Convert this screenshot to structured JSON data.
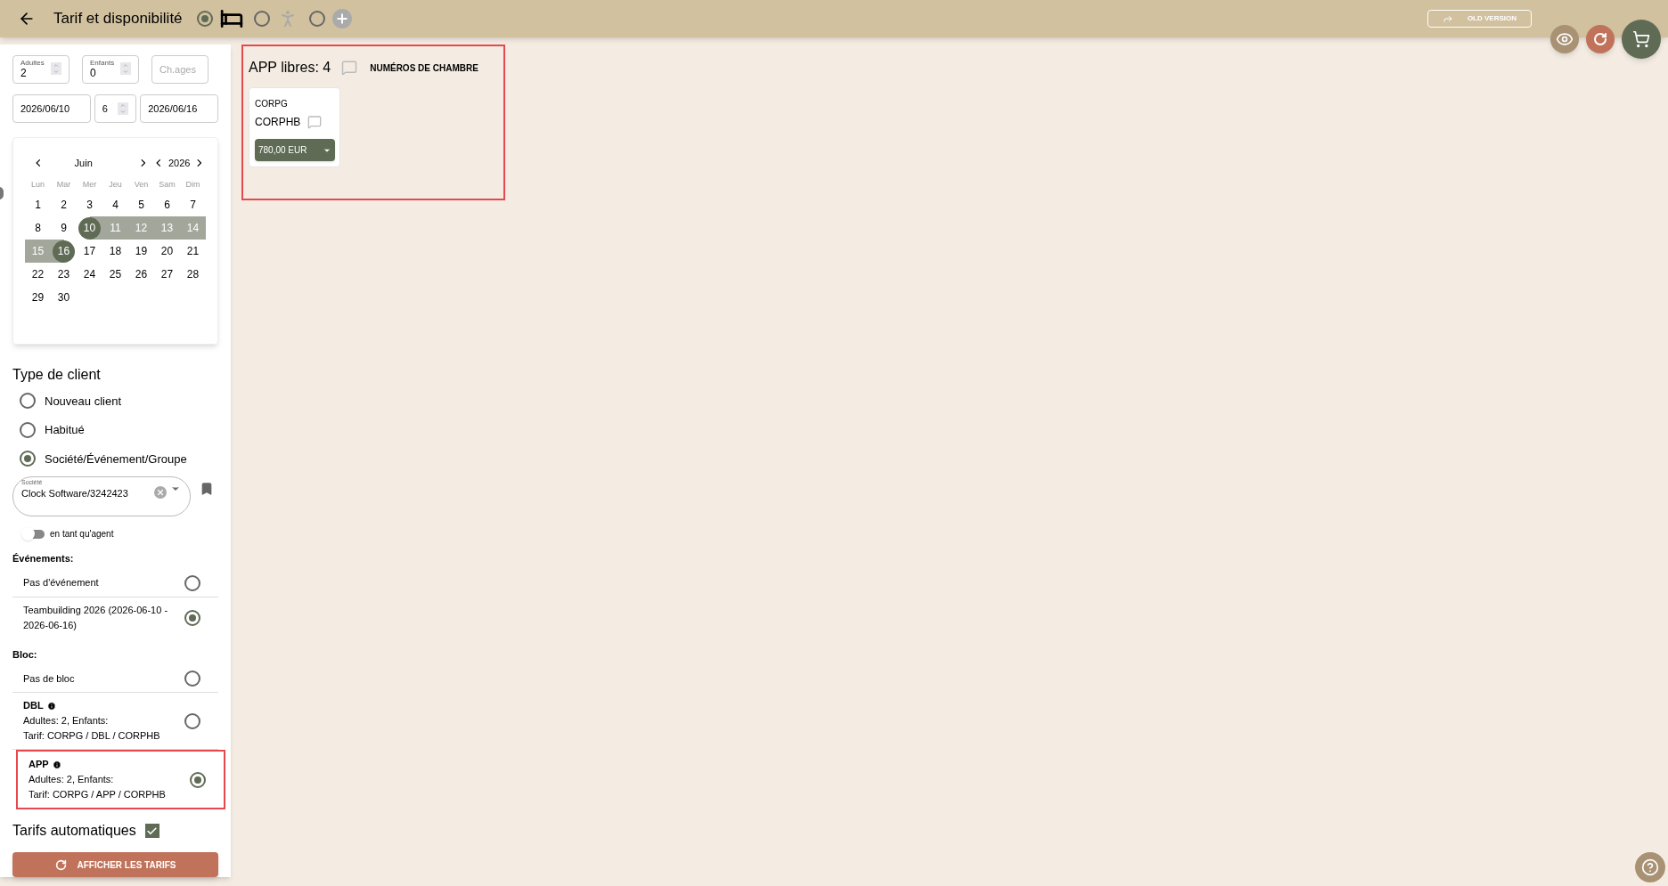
{
  "header": {
    "title": "Tarif et disponibilité",
    "modes": [
      {
        "kind": "bed",
        "selected": true
      },
      {
        "kind": "walk",
        "selected": false
      },
      {
        "kind": "add",
        "selected": false
      }
    ],
    "old_version": "OLD VERSION"
  },
  "search": {
    "adults": {
      "label": "Adultes",
      "value": "2"
    },
    "children": {
      "label": "Enfants",
      "value": "0"
    },
    "ages": {
      "placeholder": "Ch.ages"
    },
    "arrival": "2026/06/10",
    "nights": "6",
    "departure": "2026/06/16"
  },
  "calendar": {
    "month": "Juin",
    "year": "2026",
    "weekdays": [
      "Lun",
      "Mar",
      "Mer",
      "Jeu",
      "Ven",
      "Sam",
      "Dim"
    ],
    "weeks": [
      [
        {
          "day": "1",
          "selected": false,
          "in_range": false
        },
        {
          "day": "2",
          "selected": false,
          "in_range": false
        },
        {
          "day": "3",
          "selected": false,
          "in_range": false
        },
        {
          "day": "4",
          "selected": false,
          "in_range": false
        },
        {
          "day": "5",
          "selected": false,
          "in_range": false
        },
        {
          "day": "6",
          "selected": false,
          "in_range": false
        },
        {
          "day": "7",
          "selected": false,
          "in_range": false
        }
      ],
      [
        {
          "day": "8",
          "selected": false,
          "in_range": false
        },
        {
          "day": "9",
          "selected": false,
          "in_range": false
        },
        {
          "day": "10",
          "selected": true,
          "in_range": false
        },
        {
          "day": "11",
          "selected": false,
          "in_range": true
        },
        {
          "day": "12",
          "selected": false,
          "in_range": true
        },
        {
          "day": "13",
          "selected": false,
          "in_range": true
        },
        {
          "day": "14",
          "selected": false,
          "in_range": true
        }
      ],
      [
        {
          "day": "15",
          "selected": false,
          "in_range": true
        },
        {
          "day": "16",
          "selected": true,
          "in_range": false
        },
        {
          "day": "17",
          "selected": false,
          "in_range": false
        },
        {
          "day": "18",
          "selected": false,
          "in_range": false
        },
        {
          "day": "19",
          "selected": false,
          "in_range": false
        },
        {
          "day": "20",
          "selected": false,
          "in_range": false
        },
        {
          "day": "21",
          "selected": false,
          "in_range": false
        }
      ],
      [
        {
          "day": "22",
          "selected": false,
          "in_range": false
        },
        {
          "day": "23",
          "selected": false,
          "in_range": false
        },
        {
          "day": "24",
          "selected": false,
          "in_range": false
        },
        {
          "day": "25",
          "selected": false,
          "in_range": false
        },
        {
          "day": "26",
          "selected": false,
          "in_range": false
        },
        {
          "day": "27",
          "selected": false,
          "in_range": false
        },
        {
          "day": "28",
          "selected": false,
          "in_range": false
        }
      ],
      [
        {
          "day": "29",
          "selected": false,
          "in_range": false
        },
        {
          "day": "30",
          "selected": false,
          "in_range": false
        }
      ]
    ]
  },
  "client_type": {
    "title": "Type de client",
    "options": [
      {
        "label": "Nouveau client",
        "selected": false
      },
      {
        "label": "Habitué",
        "selected": false
      },
      {
        "label": "Société/Événement/Groupe",
        "selected": true
      }
    ],
    "company": {
      "label": "Société",
      "value": "Clock Software/3242423"
    },
    "agent": {
      "label": "en tant qu'agent",
      "on": false
    }
  },
  "events": {
    "title": "Événements:",
    "items": [
      {
        "label": "Pas d'événement",
        "selected": false
      },
      {
        "label": "Teambuilding 2026 (2026-06-10 - 2026-06-16)",
        "selected": true
      }
    ]
  },
  "blocks": {
    "title": "Bloc:",
    "items": [
      {
        "kind": "none",
        "label": "Pas de bloc",
        "selected": false,
        "highlighted": false
      },
      {
        "kind": "block",
        "name": "DBL",
        "guests": "Adultes: 2, Enfants:",
        "rate": "Tarif: CORPG / DBL / CORPHB",
        "selected": false,
        "highlighted": false
      },
      {
        "kind": "block",
        "name": "APP",
        "guests": "Adultes: 2, Enfants:",
        "rate": "Tarif: CORPG / APP / CORPHB",
        "selected": true,
        "highlighted": true
      }
    ]
  },
  "auto_rates": {
    "label": "Tarifs automatiques",
    "checked": true
  },
  "show_rates_button": "AFFICHER LES TARIFS",
  "availability": {
    "highlighted": true,
    "title": "APP libres: 4",
    "room_numbers": "NUMÉROS DE CHAMBRE",
    "rates": [
      {
        "group": "CORPG",
        "code": "CORPHB",
        "price": "780,00 EUR"
      }
    ]
  }
}
